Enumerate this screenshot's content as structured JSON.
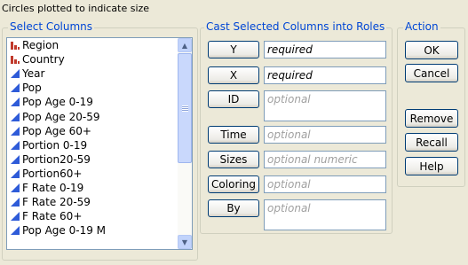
{
  "hint": "Circles plotted to indicate size",
  "select_columns": {
    "title": "Select Columns",
    "items": [
      {
        "label": "Region",
        "type": "nominal"
      },
      {
        "label": "Country",
        "type": "nominal"
      },
      {
        "label": "Year",
        "type": "continuous"
      },
      {
        "label": "Pop",
        "type": "continuous"
      },
      {
        "label": "Pop Age 0-19",
        "type": "continuous"
      },
      {
        "label": "Pop Age 20-59",
        "type": "continuous"
      },
      {
        "label": "Pop Age 60+",
        "type": "continuous"
      },
      {
        "label": "Portion 0-19",
        "type": "continuous"
      },
      {
        "label": "Portion20-59",
        "type": "continuous"
      },
      {
        "label": "Portion60+",
        "type": "continuous"
      },
      {
        "label": "F Rate 0-19",
        "type": "continuous"
      },
      {
        "label": "F Rate 20-59",
        "type": "continuous"
      },
      {
        "label": "F Rate 60+",
        "type": "continuous"
      },
      {
        "label": "Pop Age 0-19 M",
        "type": "continuous"
      }
    ]
  },
  "roles": {
    "title": "Cast Selected Columns into Roles",
    "y": {
      "button": "Y",
      "value": "required"
    },
    "x": {
      "button": "X",
      "value": "required"
    },
    "id": {
      "button": "ID",
      "value": "optional"
    },
    "time": {
      "button": "Time",
      "value": "optional"
    },
    "sizes": {
      "button": "Sizes",
      "value": "optional numeric"
    },
    "coloring": {
      "button": "Coloring",
      "value": "optional"
    },
    "by": {
      "button": "By",
      "value": "optional"
    }
  },
  "action": {
    "title": "Action",
    "ok": "OK",
    "cancel": "Cancel",
    "remove": "Remove",
    "recall": "Recall",
    "help": "Help"
  },
  "colors": {
    "group_title": "#0046D5",
    "nominal_icon": "#C0392B",
    "continuous_icon": "#2E5BD8"
  }
}
